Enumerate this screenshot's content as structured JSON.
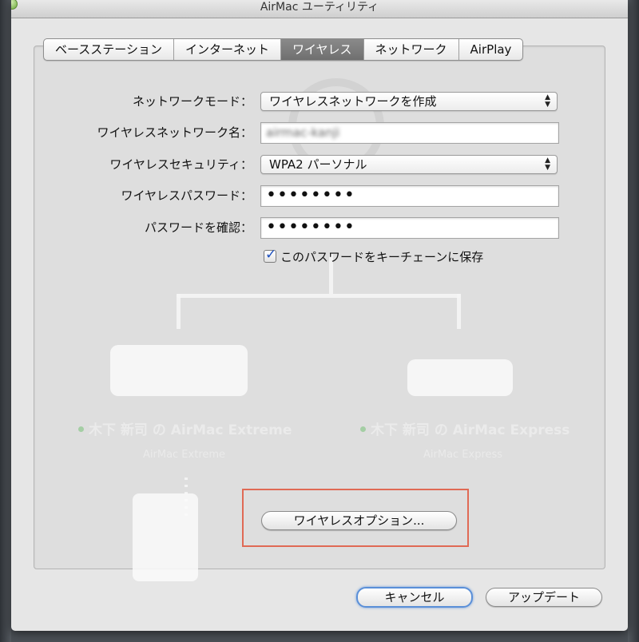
{
  "window": {
    "title": "AirMac ユーティリティ"
  },
  "tabs": [
    {
      "label": "ベースステーション",
      "active": false
    },
    {
      "label": "インターネット",
      "active": false
    },
    {
      "label": "ワイヤレス",
      "active": true
    },
    {
      "label": "ネットワーク",
      "active": false
    },
    {
      "label": "AirPlay",
      "active": false
    }
  ],
  "form": {
    "network_mode": {
      "label": "ネットワークモード：",
      "value": "ワイヤレスネットワークを作成"
    },
    "network_name": {
      "label": "ワイヤレスネットワーク名：",
      "value": "airmac-kanji"
    },
    "security": {
      "label": "ワイヤレスセキュリティ：",
      "value": "WPA2 パーソナル"
    },
    "password": {
      "label": "ワイヤレスパスワード：",
      "value": "••••••••"
    },
    "confirm": {
      "label": "パスワードを確認：",
      "value": "••••••••"
    },
    "keychain": {
      "label": "このパスワードをキーチェーンに保存",
      "checked": true
    }
  },
  "background": {
    "extreme_label": "木下 新司 の AirMac Extreme",
    "extreme_sub": "AirMac Extreme",
    "express_label": "木下 新司 の AirMac Express",
    "express_sub": "AirMac Express"
  },
  "buttons": {
    "wireless_options": "ワイヤレスオプション...",
    "cancel": "キャンセル",
    "update": "アップデート"
  },
  "colors": {
    "window_bg": "#e6e6e6",
    "active_tab": "#7a7a7a",
    "highlight": "#e06a55",
    "default_button": "#5a8fd8"
  }
}
